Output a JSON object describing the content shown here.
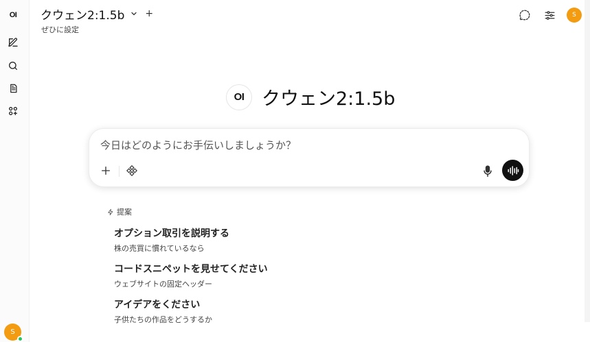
{
  "sidebar": {
    "logo": "OI",
    "user_initial": "S"
  },
  "header": {
    "model_name": "クウェン2:1.5b",
    "add_model_label": "+",
    "subtitle": "ぜひに設定",
    "user_initial": "S"
  },
  "hero": {
    "logo": "OI",
    "title": "クウェン2:1.5b"
  },
  "composer": {
    "placeholder": "今日はどのようにお手伝いしましょうか？"
  },
  "suggestions": {
    "heading": "提案",
    "items": [
      {
        "title": "オプション取引を説明する",
        "subtitle": "株の売買に慣れているなら"
      },
      {
        "title": "コードスニペットを見せてください",
        "subtitle": "ウェブサイトの固定ヘッダー"
      },
      {
        "title": "アイデアをください",
        "subtitle": "子供たちの作品をどうするか"
      }
    ]
  },
  "colors": {
    "accent_avatar": "#f39c12",
    "online_status": "#22c55e",
    "voice_button": "#111111"
  },
  "icons": [
    "new-chat-icon",
    "search-icon",
    "notes-icon",
    "workspace-icon",
    "chat-bubble-icon",
    "settings-sliders-icon",
    "plus-icon",
    "tools-icon",
    "microphone-icon",
    "voice-wave-icon",
    "lightning-icon"
  ]
}
